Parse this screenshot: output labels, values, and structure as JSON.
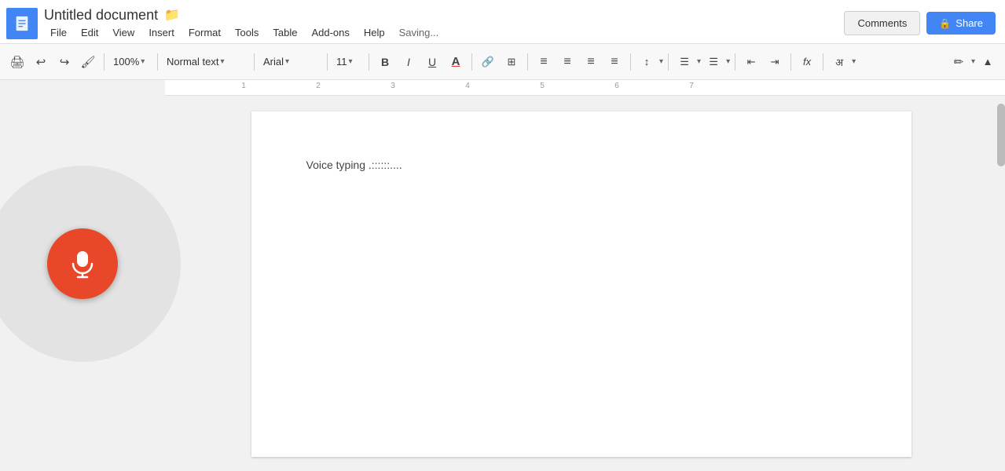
{
  "app": {
    "icon_label": "Docs",
    "title": "Untitled document",
    "folder_icon": "📁"
  },
  "menu": {
    "items": [
      "File",
      "Edit",
      "View",
      "Insert",
      "Format",
      "Tools",
      "Table",
      "Add-ons",
      "Help"
    ]
  },
  "status": {
    "saving": "Saving..."
  },
  "topright": {
    "comments": "Comments",
    "share": "Share",
    "lock_icon": "🔒"
  },
  "toolbar": {
    "zoom": "100%",
    "style": "Normal text",
    "font": "Arial",
    "size": "11",
    "bold": "B",
    "italic": "I",
    "underline": "U",
    "text_color": "A",
    "link": "🔗",
    "image_insert": "⊞",
    "align_left": "≡",
    "align_center": "≡",
    "align_right": "≡",
    "align_justify": "≡",
    "line_spacing": "↕",
    "numbered_list": "1.",
    "bullet_list": "•",
    "indent_less": "←",
    "indent_more": "→",
    "formula": "fx",
    "more": "अ",
    "pen": "✏",
    "collapse": "▲"
  },
  "document": {
    "content": "Voice typing  .::::::...."
  },
  "ruler": {
    "numbers": [
      1,
      2,
      3,
      4,
      5,
      6,
      7
    ]
  }
}
